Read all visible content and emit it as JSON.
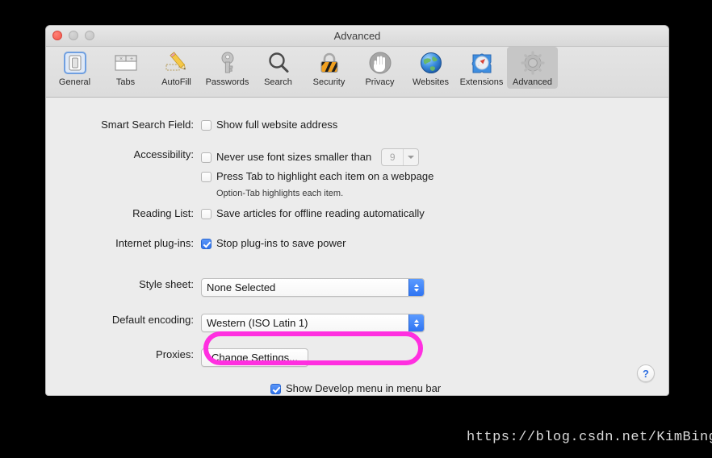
{
  "window": {
    "title": "Advanced",
    "traffic_lights": [
      "close",
      "minimize",
      "maximize"
    ]
  },
  "toolbar": {
    "items": [
      {
        "label": "General",
        "icon": "general-icon",
        "selected": false
      },
      {
        "label": "Tabs",
        "icon": "tabs-icon",
        "selected": false
      },
      {
        "label": "AutoFill",
        "icon": "autofill-icon",
        "selected": false
      },
      {
        "label": "Passwords",
        "icon": "passwords-icon",
        "selected": false
      },
      {
        "label": "Search",
        "icon": "search-icon",
        "selected": false
      },
      {
        "label": "Security",
        "icon": "security-icon",
        "selected": false
      },
      {
        "label": "Privacy",
        "icon": "privacy-icon",
        "selected": false
      },
      {
        "label": "Websites",
        "icon": "websites-icon",
        "selected": false
      },
      {
        "label": "Extensions",
        "icon": "extensions-icon",
        "selected": false
      },
      {
        "label": "Advanced",
        "icon": "advanced-icon",
        "selected": true
      }
    ]
  },
  "settings": {
    "smart_search_field": {
      "label": "Smart Search Field:",
      "checkbox_label": "Show full website address",
      "checked": false
    },
    "accessibility": {
      "label": "Accessibility:",
      "min_font": {
        "checkbox_label": "Never use font sizes smaller than",
        "checked": false,
        "value": "9",
        "disabled": true
      },
      "press_tab": {
        "checkbox_label": "Press Tab to highlight each item on a webpage",
        "checked": false
      },
      "hint": "Option-Tab highlights each item."
    },
    "reading_list": {
      "label": "Reading List:",
      "checkbox_label": "Save articles for offline reading automatically",
      "checked": false
    },
    "internet_plugins": {
      "label": "Internet plug-ins:",
      "checkbox_label": "Stop plug-ins to save power",
      "checked": true
    },
    "style_sheet": {
      "label": "Style sheet:",
      "value": "None Selected"
    },
    "default_encoding": {
      "label": "Default encoding:",
      "value": "Western (ISO Latin 1)"
    },
    "proxies": {
      "label": "Proxies:",
      "button_label": "Change Settings..."
    },
    "develop_menu": {
      "checkbox_label": "Show Develop menu in menu bar",
      "checked": true,
      "highlighted": true,
      "highlight_color": "#ff2fe0"
    }
  },
  "help": {
    "label": "?"
  },
  "watermark": {
    "text": "https://blog.csdn.net/KimBing"
  }
}
